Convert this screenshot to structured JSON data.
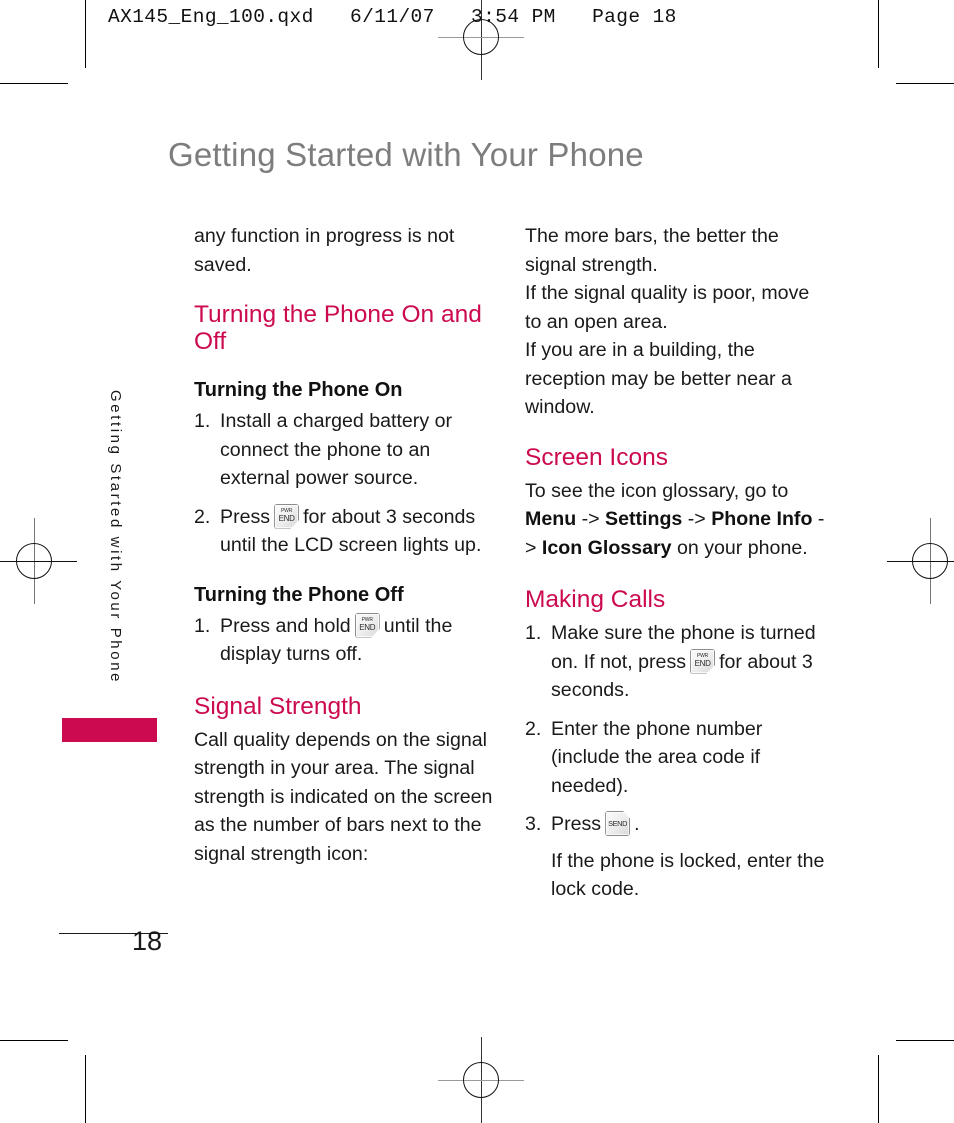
{
  "print_header": {
    "text": "AX145_Eng_100.qxd   6/11/07   3:54 PM   Page 18"
  },
  "page": {
    "title": "Getting Started with Your Phone",
    "side_tab_label": "Getting Started with Your Phone",
    "number": "18",
    "accent_color": "#cc0a50",
    "title_color": "#7d7d7d"
  },
  "icons": {
    "end_key": {
      "name": "pwr-end-key-icon",
      "line1": "PWR",
      "line2": "END"
    },
    "send_key": {
      "name": "send-key-icon",
      "line1": "SEND"
    }
  },
  "left_column": {
    "intro_paragraph": "any function in progress is not saved.",
    "section_on_off": "Turning the Phone On and Off",
    "sub_on": "Turning the Phone On",
    "steps_on": [
      {
        "num": "1.",
        "text_before": "Install a charged battery or connect the phone to an external power source.",
        "has_key": false,
        "text_after": ""
      },
      {
        "num": "2.",
        "text_before": "Press",
        "has_key": true,
        "key": "end",
        "text_after": "for about 3 seconds until the LCD screen lights up."
      }
    ],
    "sub_off": "Turning the Phone Off",
    "steps_off": [
      {
        "num": "1.",
        "text_before": "Press and hold",
        "has_key": true,
        "key": "end",
        "text_after": "until the display turns off."
      }
    ],
    "section_signal": "Signal Strength",
    "signal_paragraph": "Call quality depends on the signal strength in your area. The signal strength is indicated on the screen as the number of bars next to the signal strength icon:"
  },
  "right_column": {
    "signal_paragraphs": [
      "The more bars, the better the signal strength.",
      "If the signal quality is poor, move to an open area.",
      "If you are in a building, the reception may be better near a window."
    ],
    "section_screen_icons": "Screen Icons",
    "screen_icons_intro": "To see the icon glossary, go to",
    "nav_path": {
      "item1": "Menu",
      "arrow1": "->",
      "item2": "Settings",
      "arrow2": "->",
      "item3": "Phone Info",
      "arrow3": "->",
      "item4": "Icon Glossary",
      "tail": "on your phone."
    },
    "section_making_calls": "Making Calls",
    "steps_calls": [
      {
        "num": "1.",
        "text_before": "Make sure the phone is turned on. If not, press",
        "has_key": true,
        "key": "end",
        "text_after": "for about 3 seconds."
      },
      {
        "num": "2.",
        "text_before": "Enter the phone number (include the area code if needed).",
        "has_key": false,
        "text_after": ""
      },
      {
        "num": "3.",
        "text_before": "Press",
        "has_key": true,
        "key": "send",
        "text_after": "."
      }
    ],
    "lock_note": "If the phone is locked, enter the lock code."
  }
}
